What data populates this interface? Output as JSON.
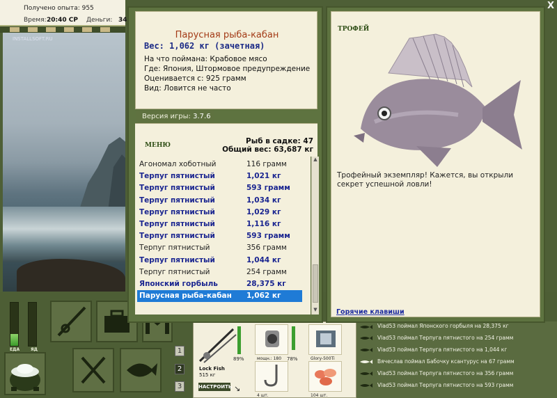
{
  "topbar": {
    "experience": "Получено опыта: 955",
    "time_label": "Время:",
    "time_value": "20:40 СР",
    "money_label": "Деньги:",
    "money_value": "34"
  },
  "scene": {
    "watermark": "INSTALLSOFT.RU"
  },
  "meters": {
    "food_label": "ЕДА",
    "poison_label": "ЯД",
    "food_level": 0.28,
    "poison_level": 0.0
  },
  "page_buttons": [
    "1",
    "2",
    "3"
  ],
  "fish_card": {
    "title": "Парусная рыба-кабан",
    "weight": "Вес: 1,062 кг (зачетная)",
    "caught_on": "На что поймана: Крабовое мясо",
    "location": "Где: Япония, Штормовое предупреждение",
    "valued_from": "Оценивается с: 925 грамм",
    "kind": "Вид: Ловится не часто"
  },
  "version": {
    "label": "Версия игры:",
    "value": "3.7.6"
  },
  "menu_label": "МЕНЮ",
  "keepnet": {
    "count": "Рыб в садке: 47",
    "total": "Общий вес: 63,687 кг"
  },
  "catch_list": [
    {
      "name": "Агономал хоботный",
      "weight": "116 грамм",
      "style": "normal"
    },
    {
      "name": "Терпуг пятнистый",
      "weight": "1,021 кг",
      "style": "bold"
    },
    {
      "name": "Терпуг пятнистый",
      "weight": "593 грамм",
      "style": "bold"
    },
    {
      "name": "Терпуг пятнистый",
      "weight": "1,034 кг",
      "style": "bold"
    },
    {
      "name": "Терпуг пятнистый",
      "weight": "1,029 кг",
      "style": "bold"
    },
    {
      "name": "Терпуг пятнистый",
      "weight": "1,116 кг",
      "style": "bold"
    },
    {
      "name": "Терпуг пятнистый",
      "weight": "593 грамм",
      "style": "bold"
    },
    {
      "name": "Терпуг пятнистый",
      "weight": "356 грамм",
      "style": "normal"
    },
    {
      "name": "Терпуг пятнистый",
      "weight": "1,044 кг",
      "style": "bold"
    },
    {
      "name": "Терпуг пятнистый",
      "weight": "254 грамм",
      "style": "normal"
    },
    {
      "name": "Японский горбыль",
      "weight": "28,375 кг",
      "style": "bold"
    },
    {
      "name": "Парусная рыба-кабан",
      "weight": "1,062 кг",
      "style": "selected"
    }
  ],
  "trophy": {
    "label": "ТРОФЕЙ",
    "message": "Трофейный экземпляр! Кажется, вы открыли секрет успешной ловли!",
    "hotkeys": "Горячие клавиши"
  },
  "close_label": "X",
  "tackle": {
    "rod_name": "Lock Fish",
    "rod_weight": "515 кг",
    "rod_percent": "89%",
    "reel_caption": "мощн.: 180",
    "reel_percent": "78%",
    "line_caption": "Glory-500Ti",
    "hook_count": "4 шт.",
    "bait_count": "104 шт.",
    "setup_label": "НАСТРОИТЬ"
  },
  "feed": [
    "Vlad53 поймал Японского горбыля на 28,375 кг",
    "Vlad53 поймал Терпуга пятнистого на 254 грамм",
    "Vlad53 поймал Терпуга пятнистого на 1,044 кг",
    "Вячеслав поймал Бабочку ксантурус на 67 грамм",
    "Vlad53 поймал Терпуга пятнистого на 356 грамм",
    "Vlad53 поймал Терпуга пятнистого на 593 грамм"
  ]
}
